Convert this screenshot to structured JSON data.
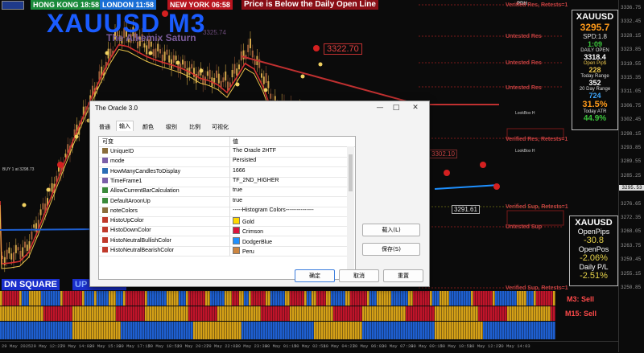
{
  "sessions": {
    "hong_kong": {
      "label": "HONG KONG 18:58",
      "color": "#1a8a3a"
    },
    "london": {
      "label": "LONDON 11:58",
      "color": "#1a6fd6"
    },
    "new_york": {
      "label": "NEW YORK 06:58",
      "color": "#b8141e"
    },
    "message": "Price is Below the Daily Open Line"
  },
  "title": "XAUUSD M3",
  "subtitle": "The Alkemix Saturn",
  "top_right_label": "PDH",
  "levels": [
    {
      "label": "Verified Res, Retests=1"
    },
    {
      "label": "Untested Res"
    },
    {
      "label": "Untested Res"
    },
    {
      "label": "Untested Res"
    },
    {
      "label": "Verified Res, Retests=1"
    },
    {
      "label": "Verified Sup, Retests=1"
    },
    {
      "label": "Untested Sup"
    },
    {
      "label": "Verified Sup, Retests=1"
    }
  ],
  "price_boxes": {
    "upper": "3322.70",
    "middle": "3302.10",
    "lower": "3291.61",
    "ghost": "3325.74"
  },
  "buy_label": "BUY 1 at 3298.73",
  "lookbox_labels": [
    "LookBox H",
    "LookBox H"
  ],
  "panel_main": {
    "symbol": "XAUUSD",
    "price": "3295.7",
    "spread": "SPD:1.8",
    "timer": "1:09",
    "daily_open_label": "DAILY OPEN",
    "daily_open": "3318.4",
    "open_pips_label": "Open Pip$",
    "open_pips": "228",
    "today_range_label": "Today Range",
    "today_range": "352",
    "day20_label": "20 Day Range",
    "day20": "724",
    "pct": "31.5%",
    "atr_label": "Today ATR",
    "atr": "44.9%"
  },
  "panel_pos": {
    "symbol": "XAUUSD",
    "open_pips_label": "OpenPips",
    "open_pips": "-30.8",
    "open_pos_label": "OpenPos",
    "open_pos": "-2.06%",
    "daily_pl_label": "Daily P/L",
    "daily_pl": "-2.51%"
  },
  "signals": {
    "dn_square": "DN SQUARE",
    "up_arrow": "UP ARROW",
    "m3": "M3: Sell",
    "m15": "M15: Sell"
  },
  "price_ticks": [
    "3336.75",
    "3332.45",
    "3328.15",
    "3323.85",
    "3319.55",
    "3315.35",
    "3311.05",
    "3306.75",
    "3302.45",
    "3298.15",
    "3293.85",
    "3289.55",
    "3285.25",
    "3280.95",
    "3276.65",
    "3272.35",
    "3268.05",
    "3263.75",
    "3259.45",
    "3255.15",
    "3250.85"
  ],
  "price_current": "3295.53",
  "time_ticks": [
    "29 May 2025",
    "29 May 12:27",
    "29 May 14:03",
    "29 May 15:39",
    "29 May 17:15",
    "29 May 18:51",
    "29 May 20:27",
    "29 May 22:03",
    "29 May 23:39",
    "30 May 01:15",
    "30 May 02:51",
    "30 May 04:27",
    "30 May 06:03",
    "30 May 07:39",
    "30 May 09:15",
    "30 May 10:51",
    "30 May 12:27",
    "30 May 14:03"
  ],
  "dialog": {
    "title": "The Oracle  3.0",
    "tabs": [
      "普通",
      "输入",
      "颜色",
      "级别",
      "比例",
      "可视化"
    ],
    "active_tab": 1,
    "col_var": "可变",
    "col_val": "值",
    "rows": [
      {
        "icon": "abc",
        "icon_color": "#8a6d3b",
        "name": "UniqueID",
        "value": "The Oracle 2HTF",
        "swatch": ""
      },
      {
        "icon": "enum",
        "icon_color": "#7a5ea8",
        "name": "mode",
        "value": "Persisted",
        "swatch": ""
      },
      {
        "icon": "01",
        "icon_color": "#2a6db5",
        "name": "HowManyCandlesToDisplay",
        "value": "1666",
        "swatch": ""
      },
      {
        "icon": "enum",
        "icon_color": "#7a5ea8",
        "name": "TimeFrame1",
        "value": "TF_2ND_HIGHER",
        "swatch": ""
      },
      {
        "icon": "bool",
        "icon_color": "#3a8a3a",
        "name": "AllowCurrentBarCalculation",
        "value": "true",
        "swatch": ""
      },
      {
        "icon": "bool",
        "icon_color": "#3a8a3a",
        "name": "DefaultAroonUp",
        "value": "true",
        "swatch": ""
      },
      {
        "icon": "abc",
        "icon_color": "#8a6d3b",
        "name": "noteColors",
        "value": "-----Histogram Colors---------------",
        "swatch": ""
      },
      {
        "icon": "color",
        "icon_color": "#c0392b",
        "name": "HistoUpColor",
        "value": "Gold",
        "swatch": "#ffd700"
      },
      {
        "icon": "color",
        "icon_color": "#c0392b",
        "name": "HistoDownColor",
        "value": "Crimson",
        "swatch": "#dc143c"
      },
      {
        "icon": "color",
        "icon_color": "#c0392b",
        "name": "HistoNeutralBullishColor",
        "value": "DodgerBlue",
        "swatch": "#1e90ff"
      },
      {
        "icon": "color",
        "icon_color": "#c0392b",
        "name": "HistoNeutralBearishColor",
        "value": "Peru",
        "swatch": "#cd853f"
      }
    ],
    "load_label": "载入(L)",
    "save_label": "保存(S)",
    "ok_label": "确定",
    "cancel_label": "取消",
    "reset_label": "重置"
  },
  "colors": {
    "accent_blue": "#1a5cff",
    "gold": "#e8c34a",
    "sell_red": "#ff4a4a",
    "hist_red": "#c0142a",
    "hist_gold": "#d4a017",
    "hist_blue": "#1e5fd0"
  }
}
